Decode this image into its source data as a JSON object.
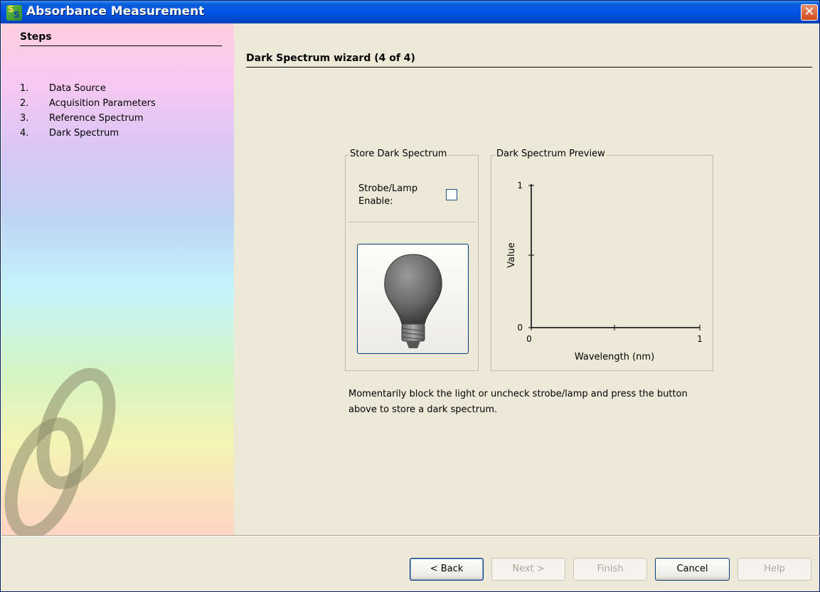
{
  "window": {
    "title": "Absorbance Measurement",
    "close_glyph": "✕"
  },
  "sidebar": {
    "title": "Steps",
    "items": [
      {
        "num": "1.",
        "label": "Data Source"
      },
      {
        "num": "2.",
        "label": "Acquisition Parameters"
      },
      {
        "num": "3.",
        "label": "Reference Spectrum"
      },
      {
        "num": "4.",
        "label": "Dark Spectrum"
      }
    ]
  },
  "main": {
    "title": "Dark Spectrum wizard (4 of 4)",
    "store_group": {
      "legend": "Store Dark Spectrum",
      "strobe_label": "Strobe/Lamp Enable:",
      "strobe_checked": false,
      "button_icon": "light-bulb-icon"
    },
    "preview_group": {
      "legend": "Dark Spectrum Preview"
    },
    "help_text": "Momentarily block the light or uncheck strobe/lamp and press the button above to store a dark spectrum."
  },
  "chart_data": {
    "type": "line",
    "title": "",
    "xlabel": "Wavelength (nm)",
    "ylabel": "Value",
    "xlim": [
      0,
      1
    ],
    "ylim": [
      0,
      1
    ],
    "x_ticks": [
      "0",
      "1"
    ],
    "y_ticks": [
      "0",
      "1"
    ],
    "series": []
  },
  "buttons": {
    "back": "< Back",
    "next": "Next >",
    "finish": "Finish",
    "cancel": "Cancel",
    "help": "Help"
  }
}
